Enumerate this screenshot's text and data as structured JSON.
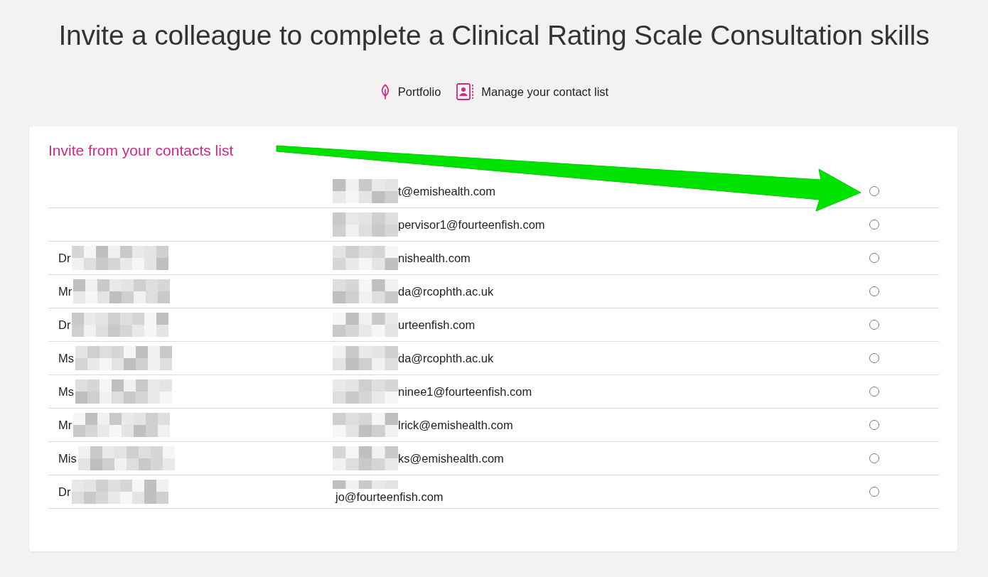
{
  "page": {
    "title": "Invite a colleague to complete a Clinical Rating Scale Consultation skills"
  },
  "nav_links": [
    {
      "kind": "portfolio",
      "label": "Portfolio"
    },
    {
      "kind": "contacts",
      "label": "Manage your contact list"
    }
  ],
  "contacts_panel": {
    "heading": "Invite from your contacts list",
    "rows": [
      {
        "kind": "masked",
        "email": "t@emishealth.com",
        "selected": false
      },
      {
        "kind": "masked",
        "email": "pervisor1@fourteenfish.com",
        "selected": false
      },
      {
        "kind": "masked",
        "title": "Dr",
        "email": "nishealth.com",
        "selected": false
      },
      {
        "kind": "masked",
        "title": "Mr",
        "email": "da@rcophth.ac.uk",
        "selected": false
      },
      {
        "kind": "masked",
        "title": "Dr",
        "email": "urteenfish.com",
        "selected": false
      },
      {
        "kind": "masked",
        "title": "Ms",
        "email": "da@rcophth.ac.uk",
        "selected": false
      },
      {
        "kind": "masked",
        "title": "Ms",
        "email": "ninee1@fourteenfish.com",
        "selected": false
      },
      {
        "kind": "masked",
        "title": "Mr",
        "email": "lrick@emishealth.com",
        "selected": false
      },
      {
        "kind": "masked",
        "title": "Mis",
        "email": "ks@emishealth.com",
        "selected": false
      },
      {
        "kind": "overlaid",
        "title": "Dr",
        "email": "jo@fourteenfish.com",
        "selected": false
      }
    ]
  },
  "annotation": {
    "kind": "arrow"
  }
}
